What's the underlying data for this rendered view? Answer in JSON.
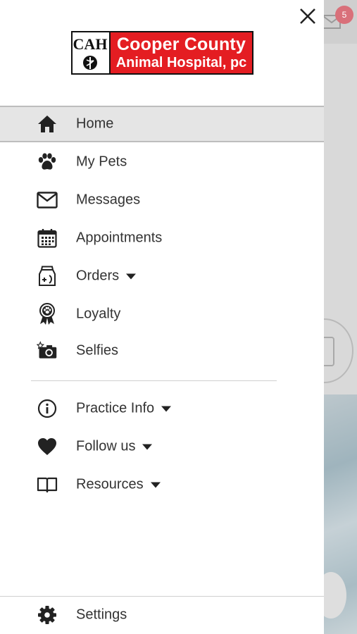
{
  "background": {
    "mail_badge_count": "5"
  },
  "drawer": {
    "logo": {
      "line1": "Cooper County",
      "line2": "Animal Hospital, pc"
    },
    "primary_items": [
      {
        "label": "Home",
        "icon": "home-icon",
        "active": true
      },
      {
        "label": "My Pets",
        "icon": "paw-icon"
      },
      {
        "label": "Messages",
        "icon": "envelope-icon"
      },
      {
        "label": "Appointments",
        "icon": "calendar-icon"
      },
      {
        "label": "Orders",
        "icon": "food-bag-icon",
        "expandable": true
      },
      {
        "label": "Loyalty",
        "icon": "award-ribbon-icon"
      },
      {
        "label": "Selfies",
        "icon": "camera-icon"
      }
    ],
    "secondary_items": [
      {
        "label": "Practice Info",
        "icon": "info-icon",
        "expandable": true
      },
      {
        "label": "Follow us",
        "icon": "heart-icon",
        "expandable": true
      },
      {
        "label": "Resources",
        "icon": "book-icon",
        "expandable": true
      }
    ],
    "footer_item": {
      "label": "Settings",
      "icon": "gear-icon"
    }
  },
  "colors": {
    "logo_red": "#e41d22",
    "active_bg": "#e5e5e5",
    "text": "#333333",
    "badge": "#d9707a"
  }
}
